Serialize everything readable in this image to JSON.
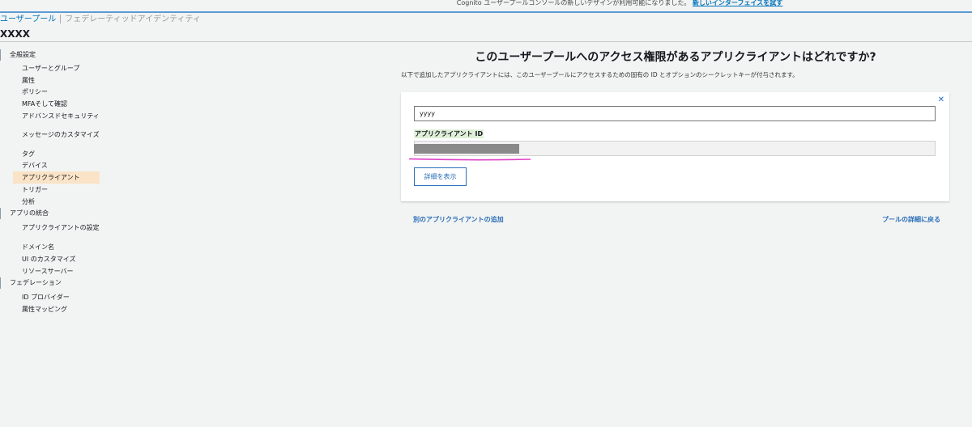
{
  "banner": {
    "text": "Cognito ユーザープールコンソールの新しいデザインが利用可能になりました。",
    "link": "新しいインターフェイスを試す"
  },
  "breadcrumb": {
    "active": "ユーザープール",
    "inactive": "フェデレーティッドアイデンティティ"
  },
  "pool_name": "XXXX",
  "sidebar": {
    "sections": [
      {
        "label": "全般設定",
        "items": [
          "ユーザーとグループ",
          "属性",
          "ポリシー",
          "MFAそして確認",
          "アドバンスドセキュリティ",
          "メッセージのカスタマイズ",
          "タグ",
          "デバイス",
          "アプリクライアント",
          "トリガー",
          "分析"
        ]
      },
      {
        "label": "アプリの統合",
        "items": [
          "アプリクライアントの設定",
          "ドメイン名",
          "UI のカスタマイズ",
          "リソースサーバー"
        ]
      },
      {
        "label": "フェデレーション",
        "items": [
          "ID プロバイダー",
          "属性マッピング"
        ]
      }
    ],
    "selected": "アプリクライアント"
  },
  "main": {
    "title": "このユーザープールへのアクセス権限があるアプリクライアントはどれですか?",
    "description": "以下で追加したアプリクライアントには、このユーザープールにアクセスするための固有の ID とオプションのシークレットキーが付与されます。",
    "client_name_value": "yyyy",
    "client_id_label": "アプリクライアント ID",
    "details_button": "詳細を表示",
    "add_client_link": "別のアプリクライアントの追加",
    "back_link": "プールの詳細に戻る",
    "close_icon": "close-icon"
  },
  "colors": {
    "accent": "#2a6fb8",
    "selected_bg": "#fae3c6",
    "highlight": "#e040c8",
    "background": "#f2f3f3"
  }
}
